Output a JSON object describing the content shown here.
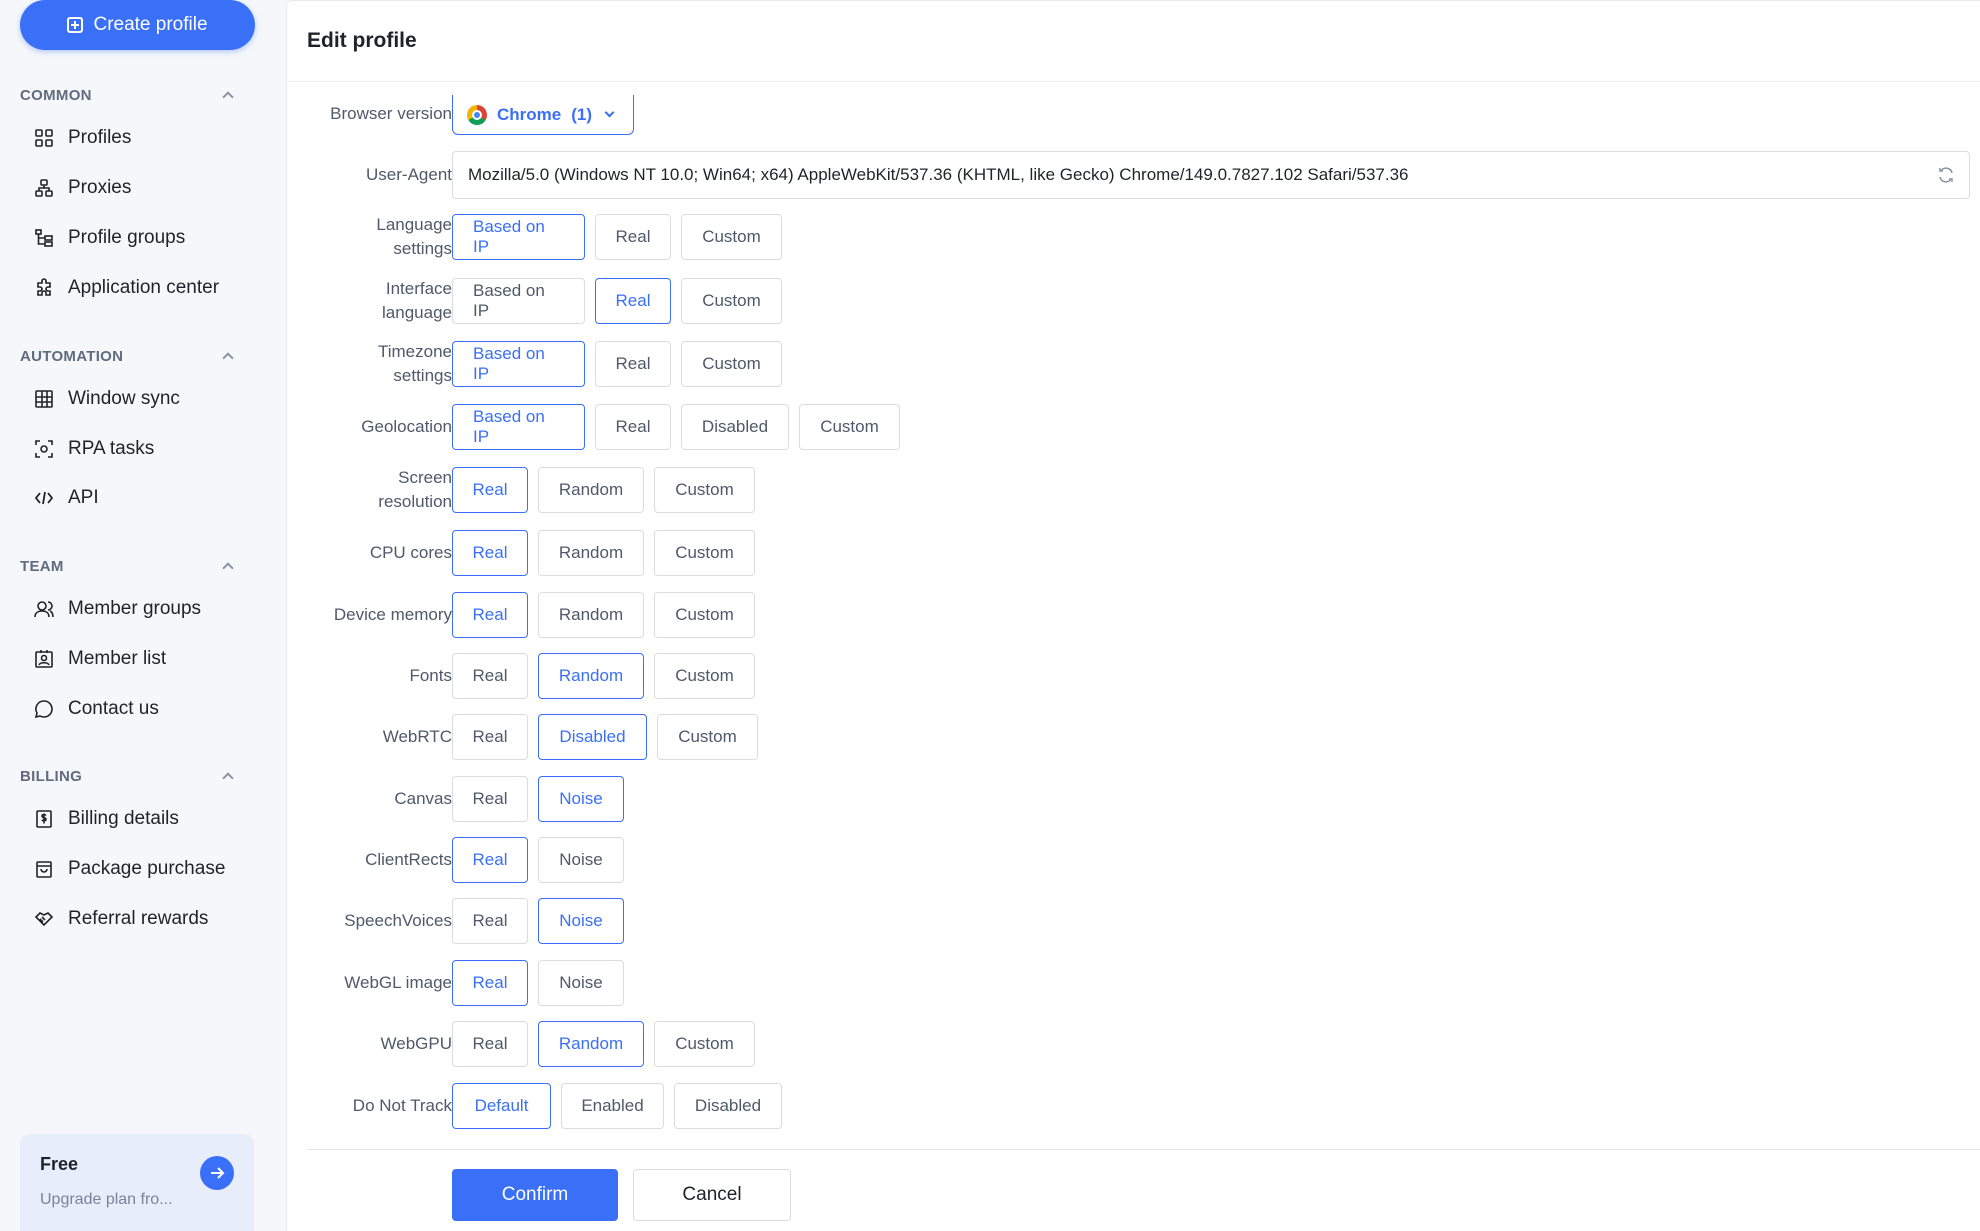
{
  "sidebar": {
    "create_label": "Create profile",
    "sections": {
      "common": {
        "title": "COMMON",
        "items": [
          "Profiles",
          "Proxies",
          "Profile groups",
          "Application center"
        ]
      },
      "automation": {
        "title": "AUTOMATION",
        "items": [
          "Window sync",
          "RPA tasks",
          "API"
        ]
      },
      "team": {
        "title": "TEAM",
        "items": [
          "Member groups",
          "Member list",
          "Contact us"
        ]
      },
      "billing": {
        "title": "BILLING",
        "items": [
          "Billing details",
          "Package purchase",
          "Referral rewards"
        ]
      }
    },
    "plan": {
      "name": "Free",
      "subtitle": "Upgrade plan fro..."
    }
  },
  "panel": {
    "title": "Edit profile",
    "browser_version": {
      "label": "Browser version",
      "browser": "Chrome",
      "count": "(1)"
    },
    "user_agent": {
      "label": "User-Agent",
      "value": "Mozilla/5.0 (Windows NT 10.0; Win64; x64) AppleWebKit/537.36 (KHTML, like Gecko) Chrome/149.0.7827.102 Safari/537.36"
    },
    "fields": {
      "language": {
        "label_l1": "Language",
        "label_l2": "settings",
        "options": [
          "Based on IP",
          "Real",
          "Custom"
        ],
        "selected": "Based on IP"
      },
      "interface": {
        "label_l1": "Interface",
        "label_l2": "language",
        "options": [
          "Based on IP",
          "Real",
          "Custom"
        ],
        "selected": "Real"
      },
      "timezone": {
        "label_l1": "Timezone",
        "label_l2": "settings",
        "options": [
          "Based on IP",
          "Real",
          "Custom"
        ],
        "selected": "Based on IP"
      },
      "geolocation": {
        "label": "Geolocation",
        "options": [
          "Based on IP",
          "Real",
          "Disabled",
          "Custom"
        ],
        "selected": "Based on IP"
      },
      "screen": {
        "label_l1": "Screen",
        "label_l2": "resolution",
        "options": [
          "Real",
          "Random",
          "Custom"
        ],
        "selected": "Real"
      },
      "cpu": {
        "label": "CPU cores",
        "options": [
          "Real",
          "Random",
          "Custom"
        ],
        "selected": "Real"
      },
      "memory": {
        "label": "Device memory",
        "options": [
          "Real",
          "Random",
          "Custom"
        ],
        "selected": "Real"
      },
      "fonts": {
        "label": "Fonts",
        "options": [
          "Real",
          "Random",
          "Custom"
        ],
        "selected": "Random"
      },
      "webrtc": {
        "label": "WebRTC",
        "options": [
          "Real",
          "Disabled",
          "Custom"
        ],
        "selected": "Disabled"
      },
      "canvas": {
        "label": "Canvas",
        "options": [
          "Real",
          "Noise"
        ],
        "selected": "Noise"
      },
      "clientrects": {
        "label": "ClientRects",
        "options": [
          "Real",
          "Noise"
        ],
        "selected": "Real"
      },
      "speechvoices": {
        "label": "SpeechVoices",
        "options": [
          "Real",
          "Noise"
        ],
        "selected": "Noise"
      },
      "webgl_image": {
        "label": "WebGL image",
        "options": [
          "Real",
          "Noise"
        ],
        "selected": "Real"
      },
      "webgpu": {
        "label": "WebGPU",
        "options": [
          "Real",
          "Random",
          "Custom"
        ],
        "selected": "Random"
      },
      "dnt": {
        "label": "Do Not Track",
        "options": [
          "Default",
          "Enabled",
          "Disabled"
        ],
        "selected": "Default"
      }
    },
    "confirm_label": "Confirm",
    "cancel_label": "Cancel"
  },
  "colors": {
    "accent": "#3a6ff7",
    "border": "#d9dde3",
    "sidebar_bg": "#f5f7fa"
  }
}
